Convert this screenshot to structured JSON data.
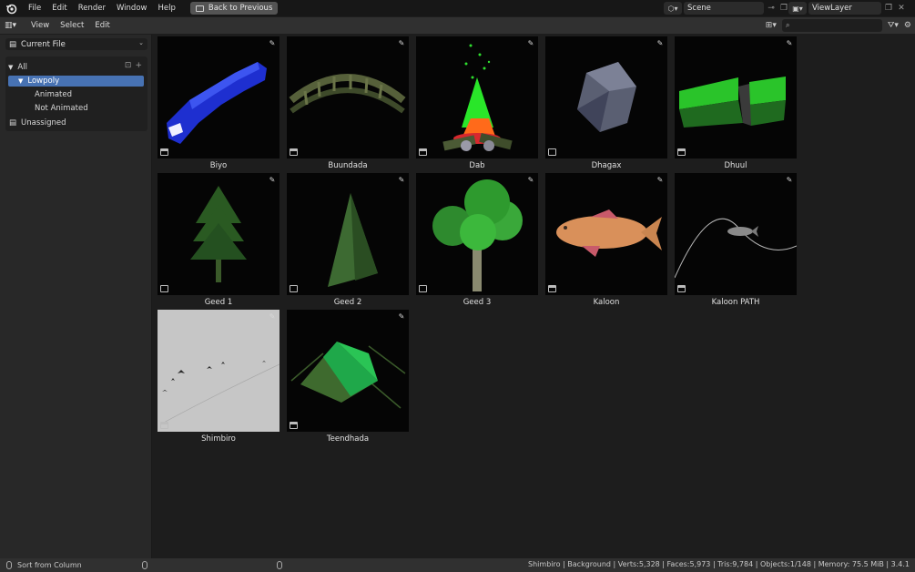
{
  "topbar": {
    "menus": [
      "File",
      "Edit",
      "Render",
      "Window",
      "Help"
    ],
    "back_button": "Back to Previous",
    "scene_name": "Scene",
    "view_layer": "ViewLayer"
  },
  "editor_header": {
    "menus": [
      "View",
      "Select",
      "Edit"
    ],
    "search_placeholder": ""
  },
  "sidebar": {
    "source": "Current File",
    "catalog": {
      "root": "All",
      "selected": "Lowpoly",
      "children": [
        "Animated",
        "Not Animated"
      ]
    },
    "unassigned": "Unassigned"
  },
  "assets": [
    {
      "name": "Biyo",
      "type": "object"
    },
    {
      "name": "Buundada",
      "type": "object"
    },
    {
      "name": "Dab",
      "type": "object"
    },
    {
      "name": "Dhagax",
      "type": "mesh"
    },
    {
      "name": "Dhuul",
      "type": "collection"
    },
    {
      "name": "Geed 1",
      "type": "mesh"
    },
    {
      "name": "Geed 2",
      "type": "mesh"
    },
    {
      "name": "Geed 3",
      "type": "mesh"
    },
    {
      "name": "Kaloon",
      "type": "collection"
    },
    {
      "name": "Kaloon PATH",
      "type": "collection"
    },
    {
      "name": "Shimbiro",
      "type": "object"
    },
    {
      "name": "Teendhada",
      "type": "collection"
    }
  ],
  "statusbar": {
    "left_hint": "Sort from Column",
    "stats": "Shimbiro | Background | Verts:5,328 | Faces:5,973 | Tris:9,784 | Objects:1/148 | Memory: 75.5 MiB | 3.4.1"
  },
  "colors": {
    "accent": "#4772b3",
    "header": "#303030",
    "background": "#1d1d1d"
  }
}
